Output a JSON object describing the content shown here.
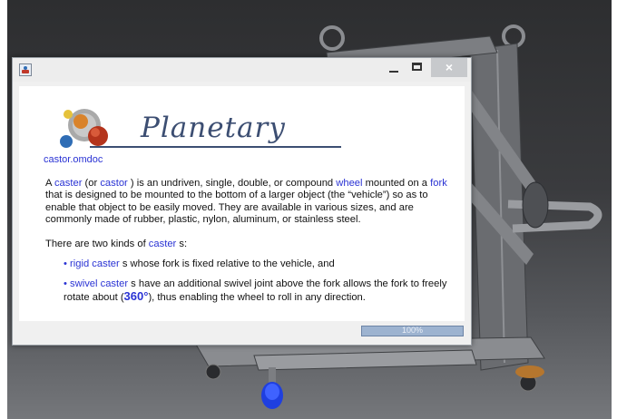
{
  "window": {
    "title": "",
    "controls": {
      "minimize": "minimize-icon",
      "maximize": "maximize-icon",
      "close": "×"
    }
  },
  "brand": {
    "name": "Planetary"
  },
  "document": {
    "source_link": "castor.omdoc",
    "paragraph1": {
      "t0": "A ",
      "l_caster": "caster",
      "t1": " (or ",
      "l_castor": "castor",
      "t2": " ) is an undriven, single, double, or compound ",
      "l_wheel": "wheel",
      "t3": " mounted on a ",
      "l_fork": "fork",
      "t4": " that is designed to be mounted to the bottom of a larger object (the “vehicle”) so as to enable that object to be easily moved. They are available in various sizes, and are commonly made of rubber, plastic, nylon, aluminum, or stainless steel."
    },
    "paragraph2": {
      "t0": "There are two kinds of ",
      "l_caster": "caster",
      "t1": " s:"
    },
    "item1": {
      "bullet": "•",
      "l_term": "rigid caster",
      "t1": " s whose fork is fixed relative to the vehicle, and"
    },
    "item2": {
      "bullet": "•",
      "l_term": "swivel caster",
      "t1": " s have an additional swivel joint above the fork allows the fork to freely rotate about (",
      "degree": "360°",
      "t2": "), thus enabling the wheel to roll in any direction."
    }
  },
  "status": {
    "progress_label": "100%",
    "progress_value": 100
  },
  "colors": {
    "link": "#2a33d4",
    "brand": "#3c4e72",
    "progress": "#8da5c4"
  }
}
